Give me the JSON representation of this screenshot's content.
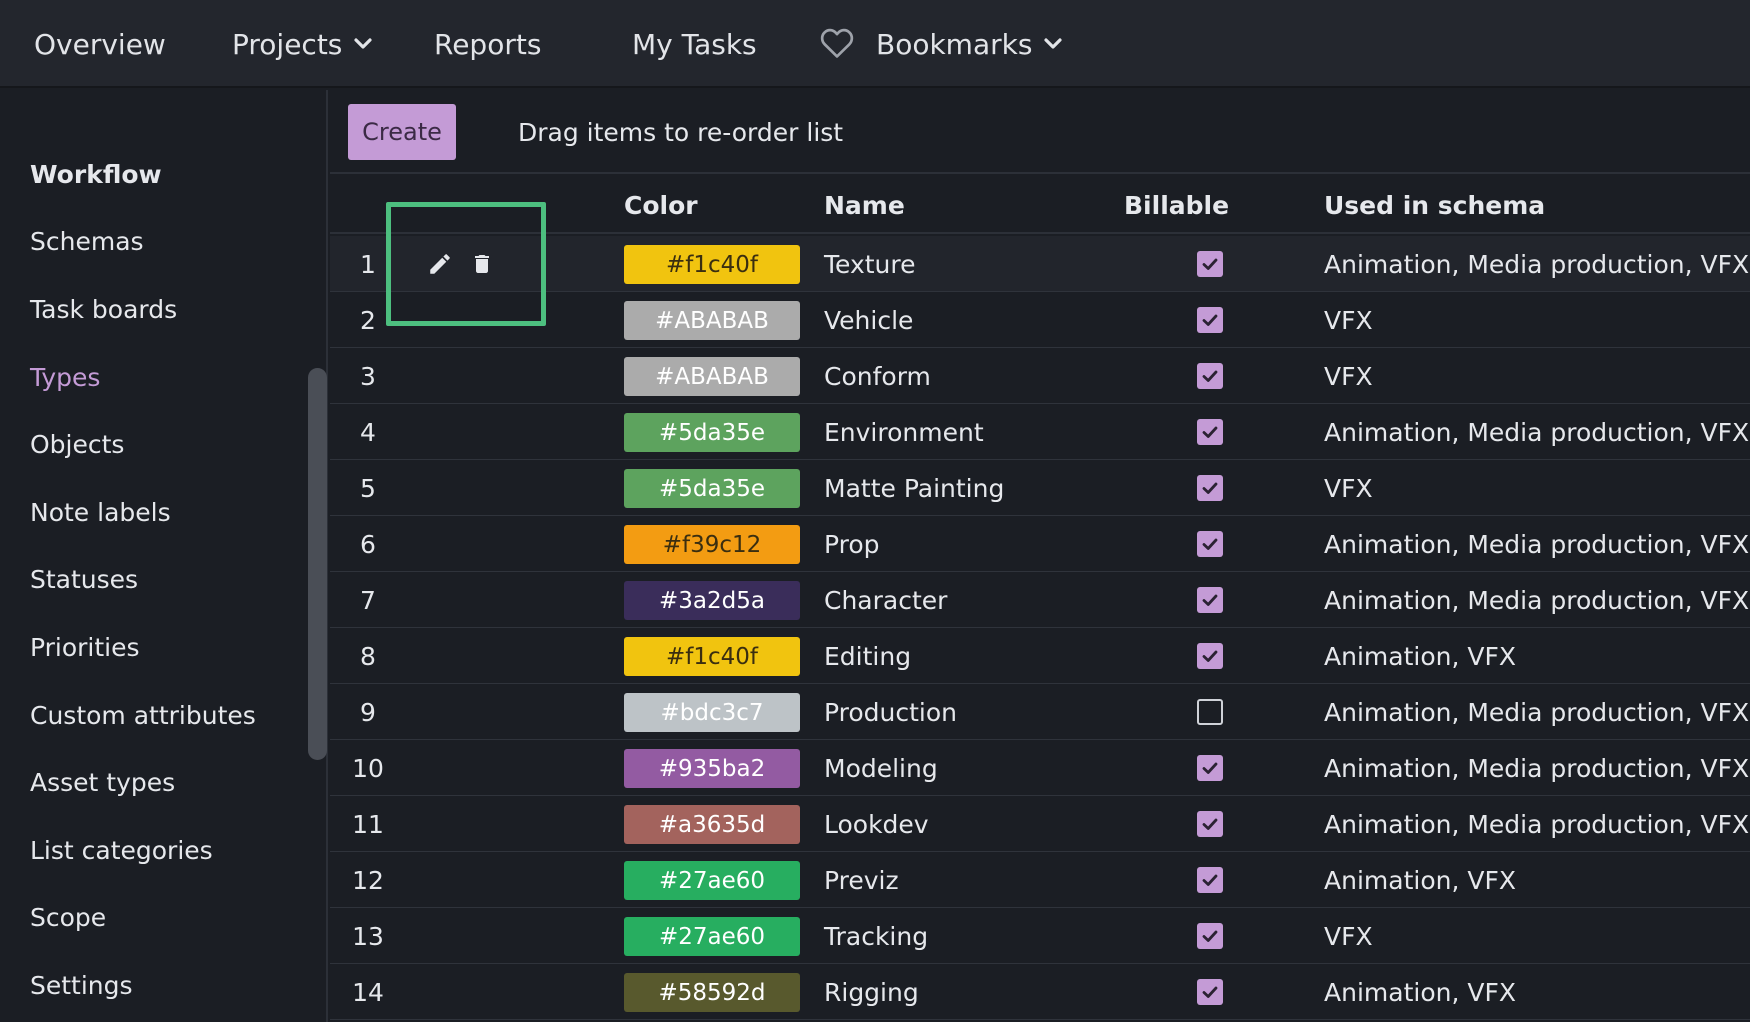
{
  "nav": {
    "overview": "Overview",
    "projects": "Projects",
    "reports": "Reports",
    "my_tasks": "My Tasks",
    "bookmarks": "Bookmarks"
  },
  "sidebar": {
    "header": "Workflow",
    "items": [
      "Schemas",
      "Task boards",
      "Types",
      "Objects",
      "Note labels",
      "Statuses",
      "Priorities",
      "Custom attributes",
      "Asset types",
      "List categories",
      "Scope",
      "Settings"
    ],
    "active": "Types"
  },
  "toolbar": {
    "create_label": "Create",
    "hint": "Drag items to re-order list"
  },
  "table": {
    "headers": {
      "color": "Color",
      "name": "Name",
      "billable": "Billable",
      "schema": "Used in schema"
    },
    "rows": [
      {
        "index": "1",
        "color": "#f1c40f",
        "name": "Texture",
        "billable": true,
        "schema": "Animation, Media production, VFX"
      },
      {
        "index": "2",
        "color": "#ABABAB",
        "name": "Vehicle",
        "billable": true,
        "schema": "VFX"
      },
      {
        "index": "3",
        "color": "#ABABAB",
        "name": "Conform",
        "billable": true,
        "schema": "VFX"
      },
      {
        "index": "4",
        "color": "#5da35e",
        "name": "Environment",
        "billable": true,
        "schema": "Animation, Media production, VFX"
      },
      {
        "index": "5",
        "color": "#5da35e",
        "name": "Matte Painting",
        "billable": true,
        "schema": "VFX"
      },
      {
        "index": "6",
        "color": "#f39c12",
        "name": "Prop",
        "billable": true,
        "schema": "Animation, Media production, VFX"
      },
      {
        "index": "7",
        "color": "#3a2d5a",
        "name": "Character",
        "billable": true,
        "schema": "Animation, Media production, VFX"
      },
      {
        "index": "8",
        "color": "#f1c40f",
        "name": "Editing",
        "billable": true,
        "schema": "Animation, VFX"
      },
      {
        "index": "9",
        "color": "#bdc3c7",
        "name": "Production",
        "billable": false,
        "schema": "Animation, Media production, VFX"
      },
      {
        "index": "10",
        "color": "#935ba2",
        "name": "Modeling",
        "billable": true,
        "schema": "Animation, Media production, VFX"
      },
      {
        "index": "11",
        "color": "#a3635d",
        "name": "Lookdev",
        "billable": true,
        "schema": "Animation, Media production, VFX"
      },
      {
        "index": "12",
        "color": "#27ae60",
        "name": "Previz",
        "billable": true,
        "schema": "Animation, VFX"
      },
      {
        "index": "13",
        "color": "#27ae60",
        "name": "Tracking",
        "billable": true,
        "schema": "VFX"
      },
      {
        "index": "14",
        "color": "#58592d",
        "name": "Rigging",
        "billable": true,
        "schema": "Animation, VFX"
      }
    ]
  },
  "theme": {
    "accent": "#c49bd6",
    "highlight": "#4dbf7f",
    "background": "#1b1e24",
    "nav_background": "#23262d"
  },
  "icons": {
    "edit": "pencil-icon",
    "delete": "trash-icon",
    "bookmark": "heart-icon",
    "dropdown": "chevron-down-icon",
    "check": "check-icon"
  }
}
